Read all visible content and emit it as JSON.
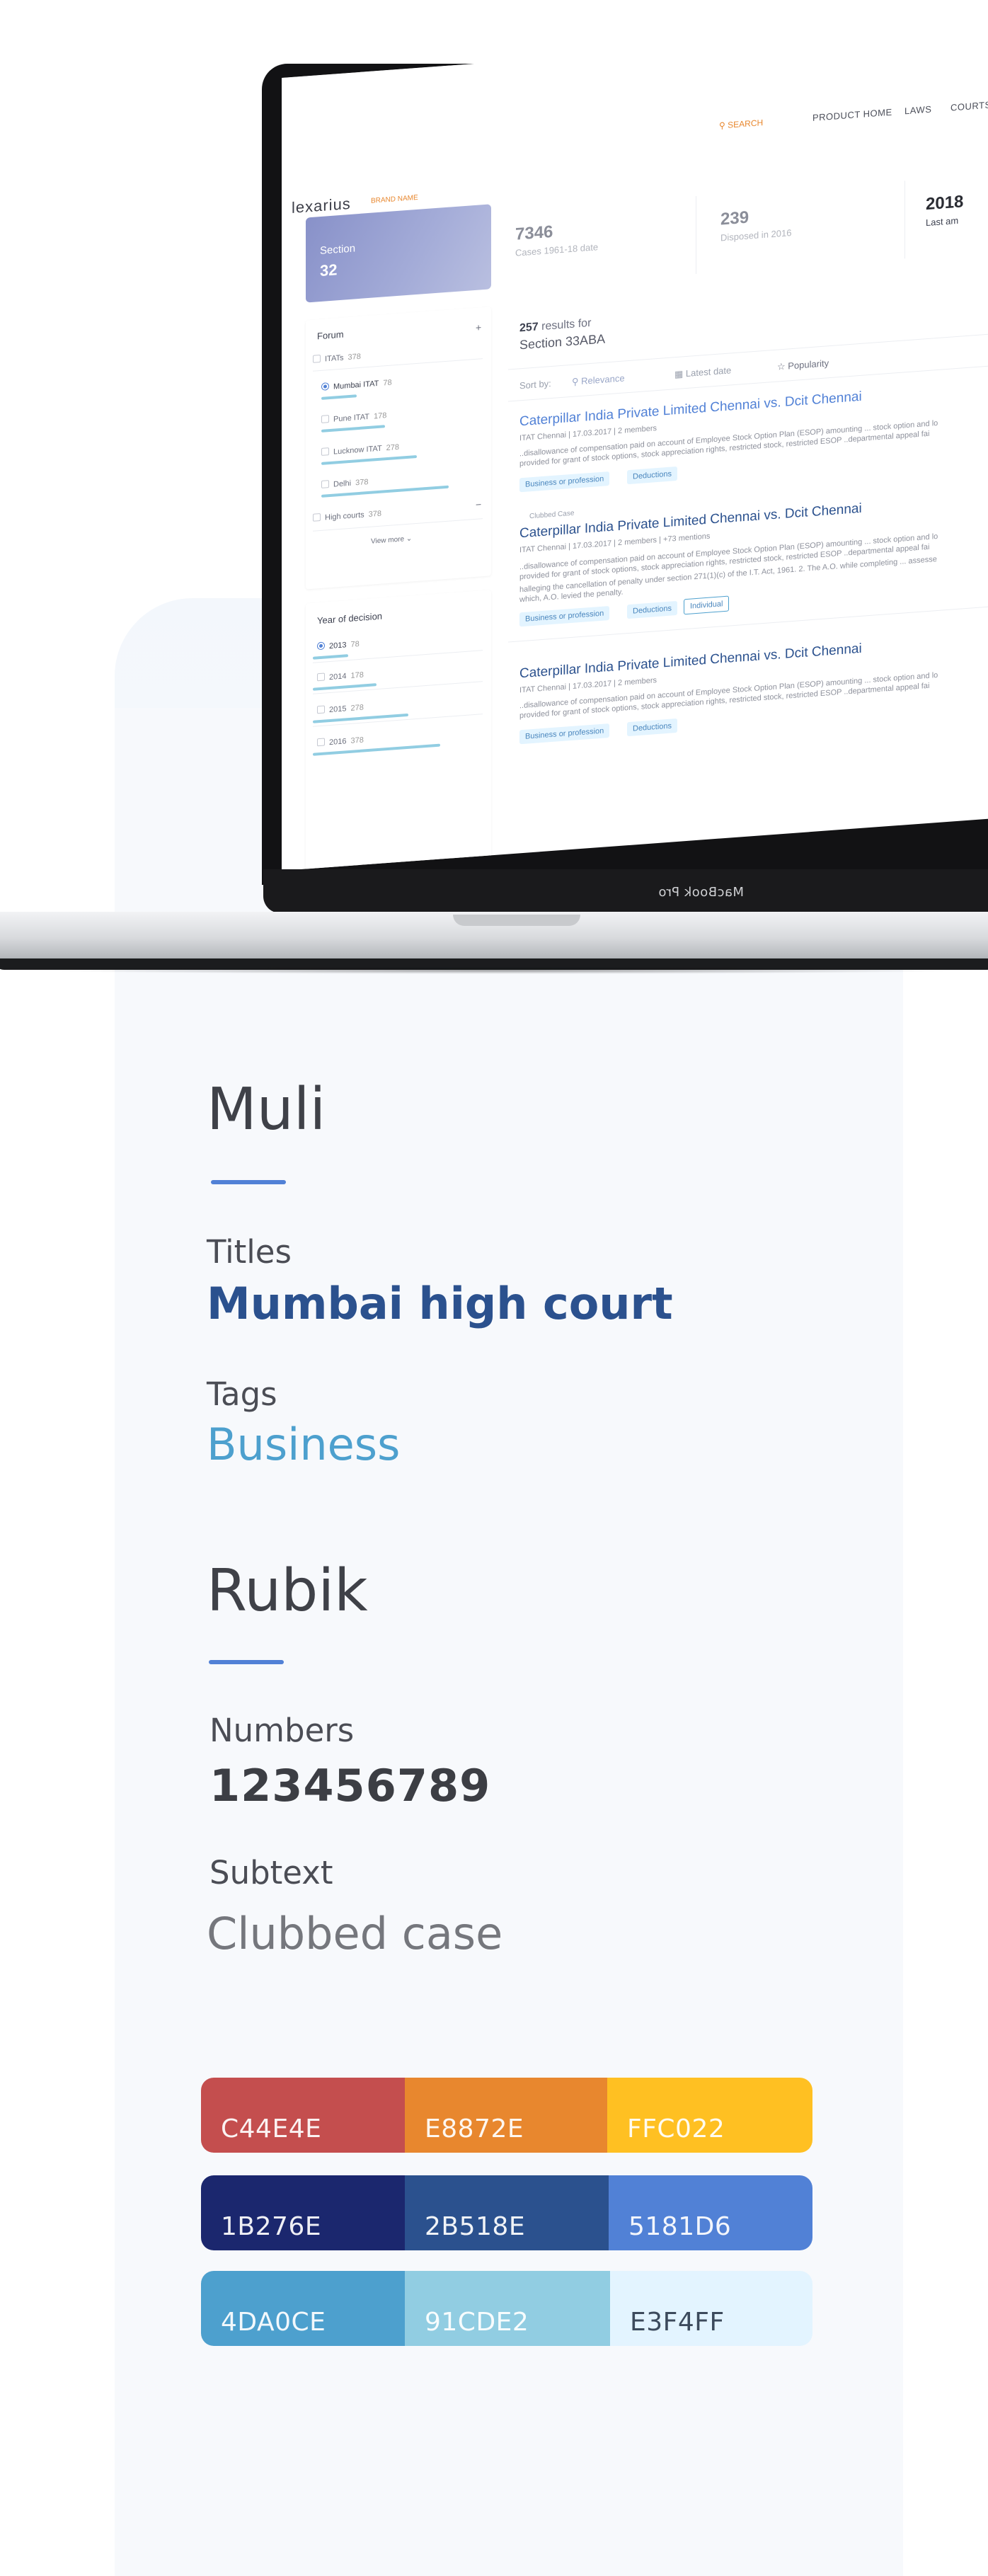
{
  "app": {
    "logo": "lexarius",
    "beta": "BRAND NAME",
    "nav": {
      "search": "SEARCH",
      "product_home": "PRODUCT HOME",
      "laws": "LAWS",
      "courts": "COURTS"
    },
    "section_card": {
      "label": "Section",
      "value": "32"
    },
    "stats": [
      {
        "value": "7346",
        "label": "Cases 1961-18 date"
      },
      {
        "value": "239",
        "label": "Disposed in 2016"
      },
      {
        "value": "2018",
        "label": "Last am"
      }
    ],
    "forum": {
      "title": "Forum",
      "itats": {
        "label": "ITATs",
        "count": "378"
      },
      "options": [
        {
          "label": "Mumbai ITAT",
          "count": "78"
        },
        {
          "label": "Pune ITAT",
          "count": "178"
        },
        {
          "label": "Lucknow ITAT",
          "count": "278"
        },
        {
          "label": "Delhi",
          "count": "378"
        }
      ],
      "high_courts": {
        "label": "High courts",
        "count": "378"
      },
      "view_more": "View more"
    },
    "year": {
      "title": "Year of decision",
      "options": [
        {
          "label": "2013",
          "count": "78"
        },
        {
          "label": "2014",
          "count": "178"
        },
        {
          "label": "2015",
          "count": "278"
        },
        {
          "label": "2016",
          "count": "378"
        }
      ]
    },
    "results": {
      "count": "257",
      "count_suffix": "results for",
      "query": "Section 33ABA",
      "sort_label": "Sort by:",
      "sort_options": [
        "Relevance",
        "Latest date",
        "Popularity"
      ],
      "cases": [
        {
          "title": "Caterpillar India Private Limited Chennai vs. Dcit Chennai",
          "meta": "ITAT Chennai  |  17.03.2017  |  2 members",
          "text1": "..disallowance of compensation paid on account of Employee Stock Option Plan (ESOP) amounting ... stock option and lo",
          "text2": "provided for grant of stock options, stock appreciation rights, restricted stock, restricted ESOP ..departmental appeal fai",
          "tags": [
            "Business or profession",
            "Deductions"
          ]
        },
        {
          "clubbed": "Clubbed Case",
          "title": "Caterpillar India Private Limited Chennai vs. Dcit Chennai",
          "meta": "ITAT Chennai  |  17.03.2017  |  2 members  |  +73 mentions",
          "text1": "..disallowance of compensation paid on account of Employee Stock Option Plan (ESOP) amounting ... stock option and lo",
          "text2": "provided for grant of stock options, stock appreciation rights, restricted stock, restricted ESOP ..departmental appeal fai",
          "text3": "halleging the cancellation of penalty under section 271(1)(c) of the I.T. Act, 1961. 2. The A.O. while completing ... assesse",
          "text4": "which, A.O. levied the penalty.",
          "tags": [
            "Business or profession",
            "Deductions",
            "Individual"
          ]
        },
        {
          "title": "Caterpillar India Private Limited Chennai vs. Dcit Chennai",
          "meta": "ITAT Chennai  |  17.03.2017  |  2 members",
          "text1": "..disallowance of compensation paid on account of Employee Stock Option Plan (ESOP) amounting ... stock option and lo",
          "text2": "provided for grant of stock options, stock appreciation rights, restricted stock, restricted ESOP ..departmental appeal fai",
          "tags": [
            "Business or profession",
            "Deductions"
          ]
        }
      ]
    },
    "device_label": "MacBook Pro"
  },
  "typography": {
    "muli": {
      "name": "Muli",
      "titles_label": "Titles",
      "titles_sample": "Mumbai high court",
      "tags_label": "Tags",
      "tags_sample": "Business"
    },
    "rubik": {
      "name": "Rubik",
      "numbers_label": "Numbers",
      "numbers_sample": "123456789",
      "subtext_label": "Subtext",
      "subtext_sample": "Clubbed case"
    }
  },
  "palette": [
    [
      "C44E4E",
      "E8872E",
      "FFC022"
    ],
    [
      "1B276E",
      "2B518E",
      "5181D6"
    ],
    [
      "4DA0CE",
      "91CDE2",
      "E3F4FF"
    ]
  ],
  "palette_hex": [
    [
      "#C44E4E",
      "#E8872E",
      "#FFC022"
    ],
    [
      "#1B276E",
      "#2B518E",
      "#5181D6"
    ],
    [
      "#4DA0CE",
      "#91CDE2",
      "#E3F4FF"
    ]
  ],
  "colors": {
    "accent": "#5181d6",
    "title": "#2b518e",
    "tag": "#4da0ce"
  }
}
